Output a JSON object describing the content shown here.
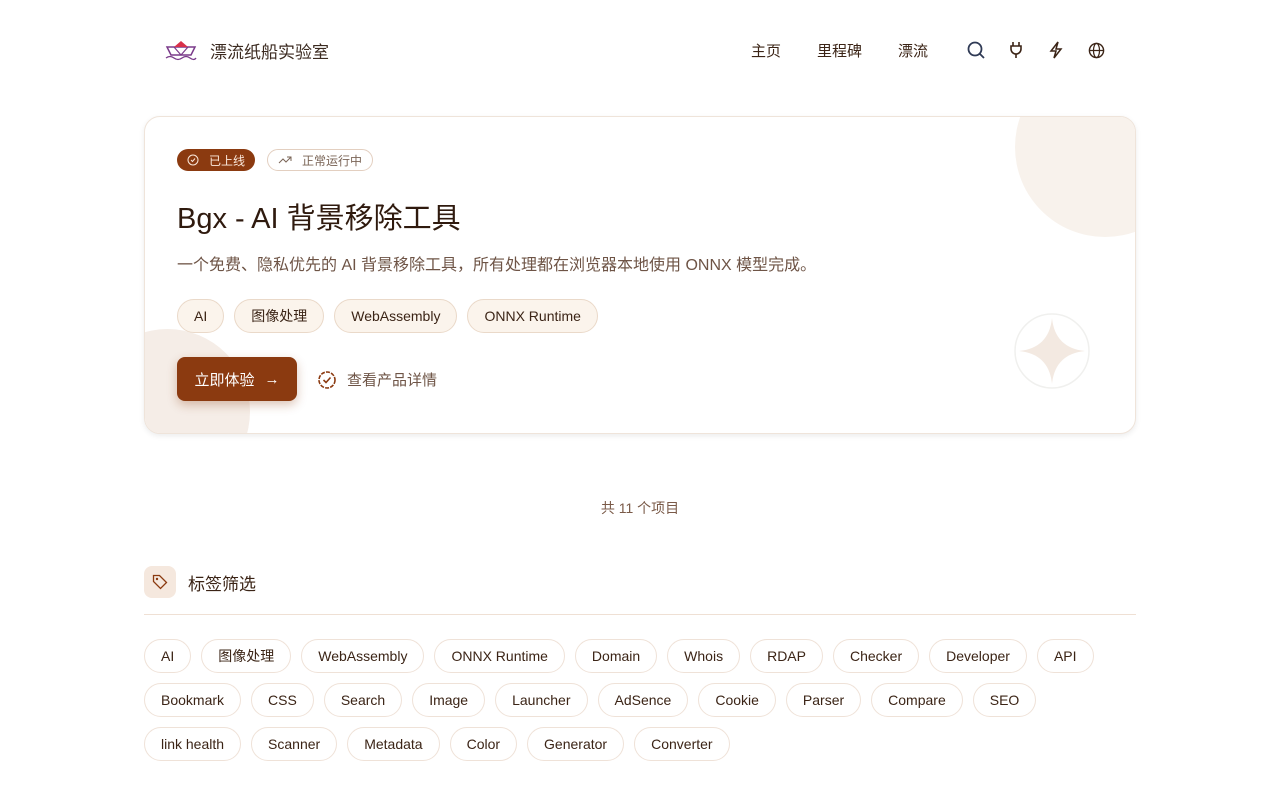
{
  "header": {
    "site_name": "漂流纸船实验室",
    "nav": [
      "主页",
      "里程碑",
      "漂流"
    ]
  },
  "card": {
    "status_badge": "已上线",
    "running_badge": "正常运行中",
    "title": "Bgx - AI 背景移除工具",
    "description": "一个免费、隐私优先的 AI 背景移除工具，所有处理都在浏览器本地使用 ONNX 模型完成。",
    "tags": [
      "AI",
      "图像处理",
      "WebAssembly",
      "ONNX Runtime"
    ],
    "cta_label": "立即体验",
    "detail_label": "查看产品详情"
  },
  "count_text": "共 11 个项目",
  "filter": {
    "title": "标签筛选",
    "tags": [
      "AI",
      "图像处理",
      "WebAssembly",
      "ONNX Runtime",
      "Domain",
      "Whois",
      "RDAP",
      "Checker",
      "Developer",
      "API",
      "Bookmark",
      "CSS",
      "Search",
      "Image",
      "Launcher",
      "AdSence",
      "Cookie",
      "Parser",
      "Compare",
      "SEO",
      "link health",
      "Scanner",
      "Metadata",
      "Color",
      "Generator",
      "Converter"
    ]
  },
  "colors": {
    "accent": "#8b3a10"
  }
}
